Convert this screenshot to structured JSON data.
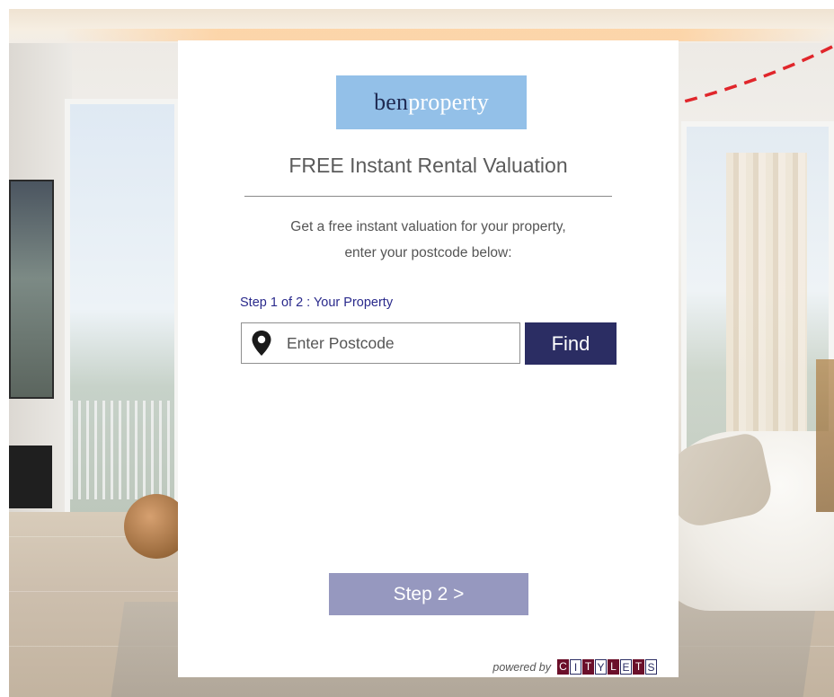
{
  "brand": {
    "logo_part1": "ben",
    "logo_part2": "property",
    "logo_bg": "#93c0e8"
  },
  "card": {
    "title": "FREE Instant Rental Valuation",
    "desc_line1": "Get a free instant valuation for your property,",
    "desc_line2": "enter your postcode below:",
    "step_label": "Step 1 of 2 : Your Property"
  },
  "search": {
    "placeholder": "Enter Postcode",
    "value": "",
    "icon": "map-pin-icon",
    "find_label": "Find"
  },
  "footer": {
    "step2_label": "Step 2 >",
    "powered_by": "powered by",
    "citylets_letters": [
      "C",
      "I",
      "T",
      "Y",
      "L",
      "E",
      "T",
      "S"
    ]
  },
  "colors": {
    "accent_navy": "#2b2d63",
    "step_button": "#9698bf",
    "arrow_red": "#e0262b",
    "citylets_burgundy": "#6b0f2a"
  }
}
